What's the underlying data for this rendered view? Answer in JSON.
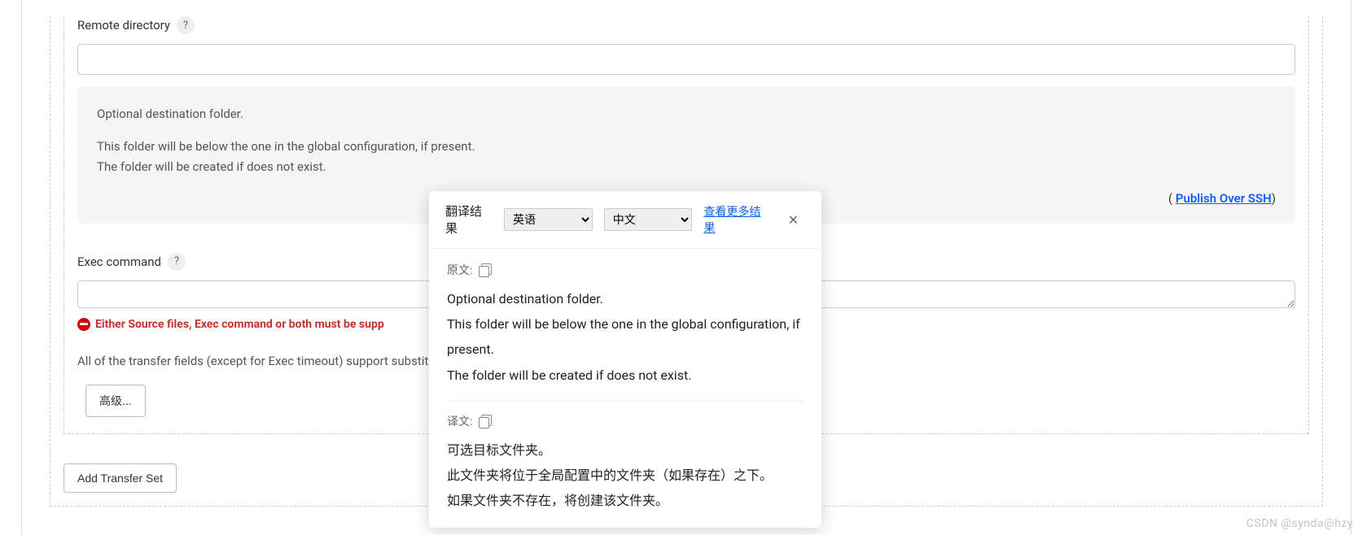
{
  "remote_directory": {
    "label": "Remote directory",
    "help_tooltip": "?",
    "value": ""
  },
  "help_box": {
    "line1": "Optional destination folder.",
    "line2": "This folder will be below the one in the global configuration, if present.",
    "line3": "The folder will be created if does not exist.",
    "link_prefix": "( ",
    "link_text": "Publish Over SSH",
    "link_suffix": ")"
  },
  "exec_command": {
    "label": "Exec command",
    "help_tooltip": "?",
    "value": ""
  },
  "error_message": "Either Source files, Exec command or both must be supp",
  "substitution_note": "All of the transfer fields (except for Exec timeout) support substit",
  "buttons": {
    "advanced": "高级...",
    "add_transfer_set": "Add Transfer Set"
  },
  "translate": {
    "title": "翻译结果",
    "from_lang": "英语",
    "to_lang": "中文",
    "more_results": "查看更多结果",
    "original_label": "原文:",
    "original_text_1": "Optional destination folder.",
    "original_text_2": "This folder will be below the one in the global configuration, if present.",
    "original_text_3": "The folder will be created if does not exist.",
    "translated_label": "译文:",
    "translated_text_1": "可选目标文件夹。",
    "translated_text_2": "此文件夹将位于全局配置中的文件夹（如果存在）之下。",
    "translated_text_3": "如果文件夹不存在，将创建该文件夹。"
  },
  "watermark": "CSDN @synda@hzy"
}
